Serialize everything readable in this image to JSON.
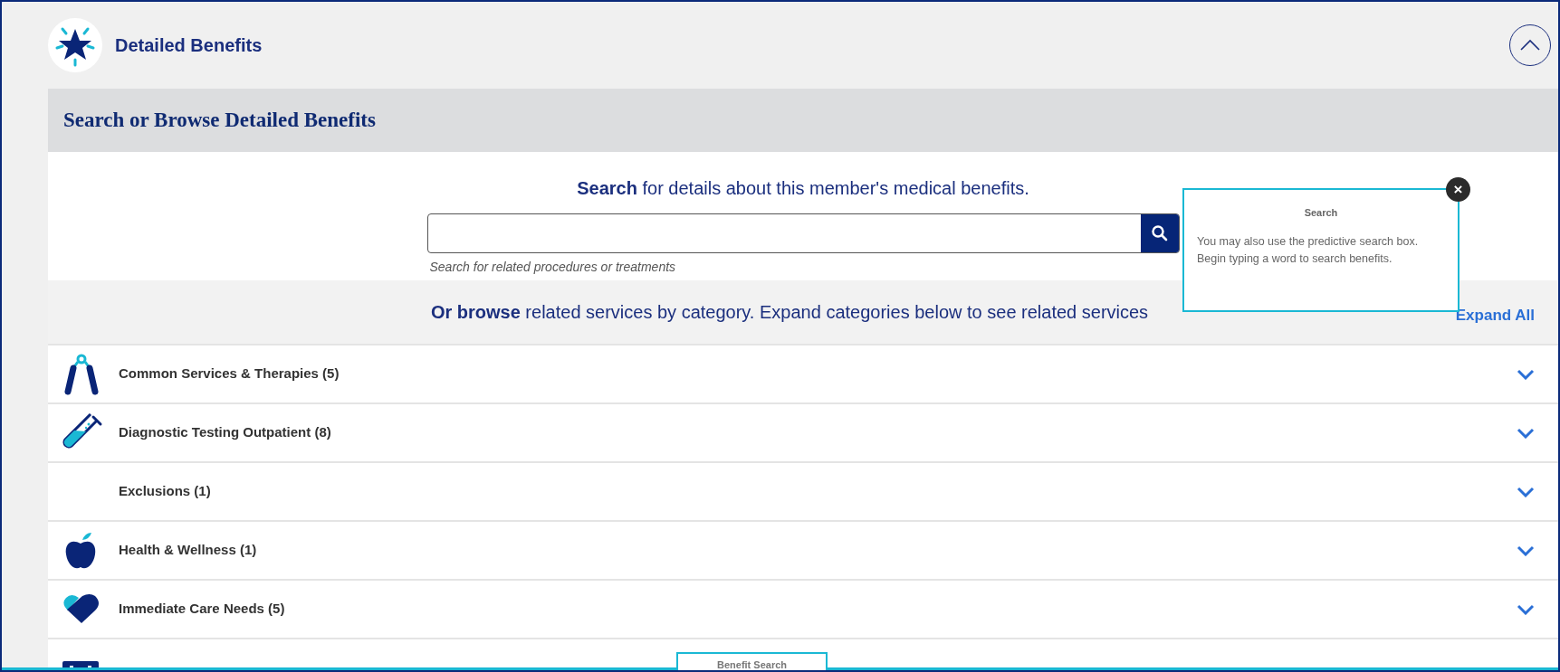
{
  "section": {
    "title": "Detailed Benefits",
    "expanded": true
  },
  "card": {
    "title": "Search or Browse Detailed Benefits"
  },
  "search": {
    "heading": "**Search** for details about this member's medical benefits.",
    "hint": "Search for related procedures or treatments"
  },
  "browse": {
    "text": "**Or browse** related services by category. Expand categories below to see related services",
    "expand_all": "Expand All"
  },
  "categories": [
    {
      "kind": "grip",
      "label": "Common Services & Therapies (5)",
      "expanded": false
    },
    {
      "kind": "tube",
      "label": "Diagnostic Testing Outpatient (8)",
      "expanded": false
    },
    {
      "kind": "none",
      "label": "Exclusions (1)",
      "expanded": false
    },
    {
      "kind": "apple",
      "label": "Health & Wellness (1)",
      "expanded": false
    },
    {
      "kind": "heart",
      "label": "Immediate Care Needs (5)",
      "expanded": false
    },
    {
      "kind": "kit"
    }
  ],
  "tooltip": {
    "title": "Search",
    "body": "You may also use the predictive search box. Begin typing a word to search benefits.",
    "close": "×"
  },
  "bottom_tab": {
    "label": "Benefit Search"
  }
}
